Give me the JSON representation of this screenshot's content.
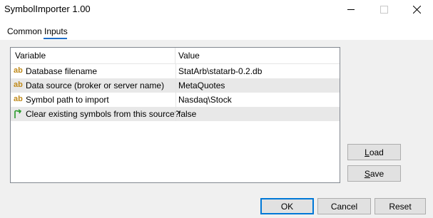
{
  "window": {
    "title": "SymbolImporter 1.00"
  },
  "tabs": [
    {
      "label": "Common"
    },
    {
      "label": "Inputs"
    }
  ],
  "grid": {
    "columns": [
      "Variable",
      "Value"
    ],
    "rows": [
      {
        "icon": "ab",
        "variable": "Database filename",
        "value": "StatArb\\statarb-0.2.db"
      },
      {
        "icon": "ab",
        "variable": "Data source (broker or server name)",
        "value": "MetaQuotes"
      },
      {
        "icon": "ab",
        "variable": "Symbol path to import",
        "value": "Nasdaq\\Stock"
      },
      {
        "icon": "flag-arrow-icon",
        "variable": "Clear existing symbols from this source?",
        "value": "false"
      }
    ]
  },
  "side_buttons": {
    "load": {
      "accel": "L",
      "rest": "oad"
    },
    "save": {
      "accel": "S",
      "rest": "ave"
    }
  },
  "footer": {
    "ok": "OK",
    "cancel": "Cancel",
    "reset": "Reset"
  },
  "colors": {
    "accent": "#0078d7",
    "icon_ab": "#c08a1a",
    "icon_flag": "#2a9a2a"
  }
}
